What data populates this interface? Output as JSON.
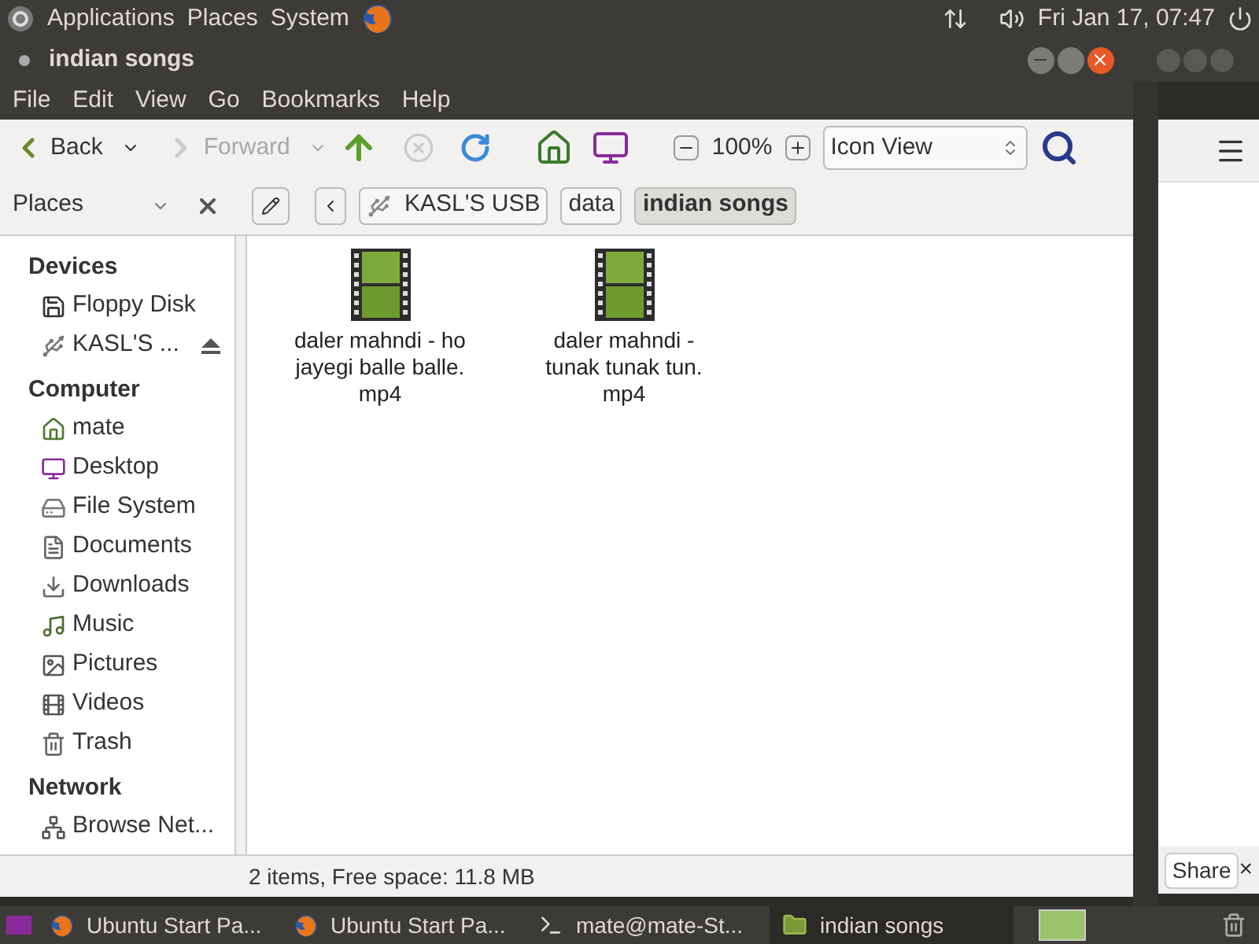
{
  "top_panel": {
    "menus": [
      "Applications",
      "Places",
      "System"
    ],
    "clock": "Fri Jan 17, 07:47"
  },
  "window": {
    "title": "indian songs"
  },
  "menu_bar": [
    "File",
    "Edit",
    "View",
    "Go",
    "Bookmarks",
    "Help"
  ],
  "toolbar": {
    "back": {
      "label": "Back",
      "disabled": false
    },
    "forward": {
      "label": "Forward",
      "disabled": true
    },
    "zoom": "100%",
    "view_select": "Icon View"
  },
  "location_bar": {
    "pane_select": "Places",
    "path": [
      {
        "label": "KASL'S USB",
        "kind": "drive",
        "selected": false
      },
      {
        "label": "data",
        "kind": "folder",
        "selected": false
      },
      {
        "label": "indian songs",
        "kind": "folder",
        "selected": true
      }
    ]
  },
  "sidebar": [
    {
      "heading": "Devices",
      "items": [
        {
          "label": "Floppy Disk",
          "kind": "floppy",
          "eject": false
        },
        {
          "label": "KASL'S ...",
          "kind": "usb",
          "eject": true
        }
      ]
    },
    {
      "heading": "Computer",
      "items": [
        {
          "label": "mate",
          "kind": "home",
          "eject": false
        },
        {
          "label": "Desktop",
          "kind": "desktop",
          "eject": false
        },
        {
          "label": "File System",
          "kind": "disk",
          "eject": false
        },
        {
          "label": "Documents",
          "kind": "documents",
          "eject": false
        },
        {
          "label": "Downloads",
          "kind": "downloads",
          "eject": false
        },
        {
          "label": "Music",
          "kind": "music",
          "eject": false
        },
        {
          "label": "Pictures",
          "kind": "pictures",
          "eject": false
        },
        {
          "label": "Videos",
          "kind": "videos",
          "eject": false
        },
        {
          "label": "Trash",
          "kind": "trash",
          "eject": false
        }
      ]
    },
    {
      "heading": "Network",
      "items": [
        {
          "label": "Browse Net...",
          "kind": "network",
          "eject": false
        }
      ]
    }
  ],
  "files": [
    {
      "name_lines": [
        "daler mahndi - ho",
        "jayegi balle balle.",
        "mp4"
      ]
    },
    {
      "name_lines": [
        "daler mahndi -",
        "tunak tunak tun.",
        "mp4"
      ]
    }
  ],
  "status_bar": "2 items, Free space: 11.8 MB",
  "background_window": {
    "button": "Share",
    "close": "×"
  },
  "taskbar": [
    {
      "label": "Ubuntu Start Pa...",
      "kind": "browser",
      "selected": false
    },
    {
      "label": "Ubuntu Start Pa...",
      "kind": "browser",
      "selected": false
    },
    {
      "label": "mate@mate-St...",
      "kind": "terminal",
      "selected": false
    },
    {
      "label": "indian songs",
      "kind": "folder",
      "selected": true
    }
  ]
}
